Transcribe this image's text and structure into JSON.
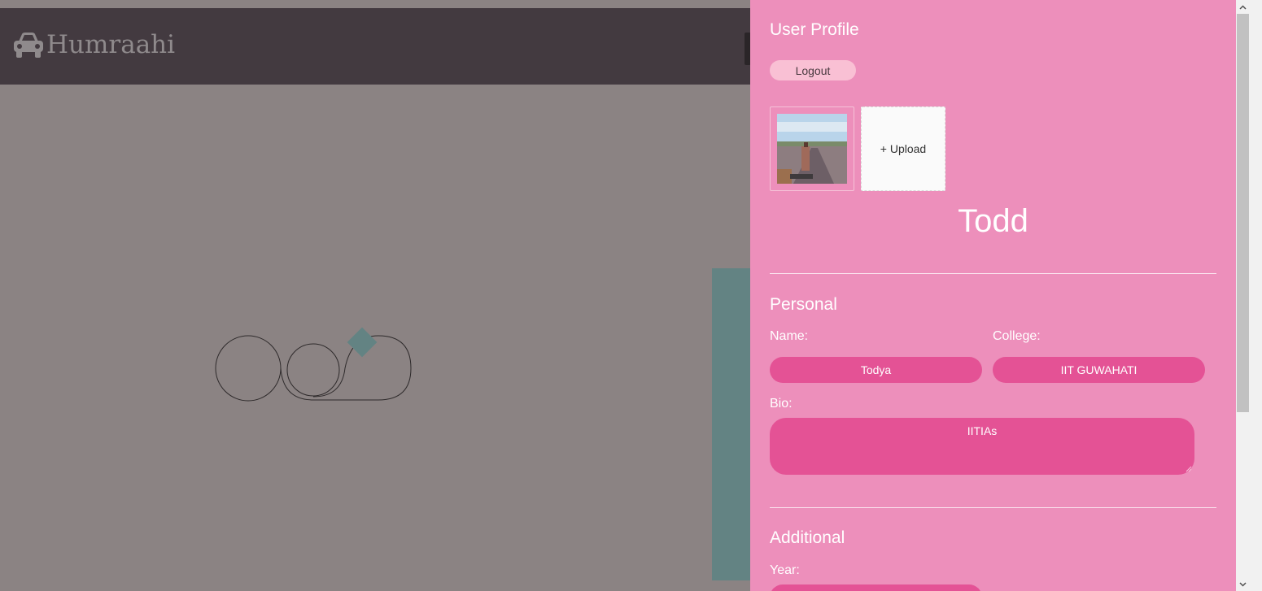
{
  "navbar": {
    "brand_icon": "car-icon",
    "brand_name": "Humraahi"
  },
  "profile_drawer": {
    "title": "User Profile",
    "logout_label": "Logout",
    "upload_label": "+ Upload",
    "display_name": "Todd",
    "personal": {
      "title": "Personal",
      "name_label": "Name:",
      "name_value": "Todya",
      "college_label": "College:",
      "college_value": "IIT GUWAHATI",
      "bio_label": "Bio:",
      "bio_value": "IITIAs"
    },
    "additional": {
      "title": "Additional",
      "year_label": "Year:"
    }
  },
  "colors": {
    "navbar": "#433a40",
    "drawer": "#ed8fbb",
    "input_fill": "#e45295",
    "logout_button": "#f9c0d4",
    "overlay": "#8b8383",
    "teal_panel": "#638383"
  },
  "icons": [
    "car-icon",
    "loading-spinner",
    "scroll-up-icon",
    "scroll-down-icon",
    "resize-grip-icon"
  ]
}
